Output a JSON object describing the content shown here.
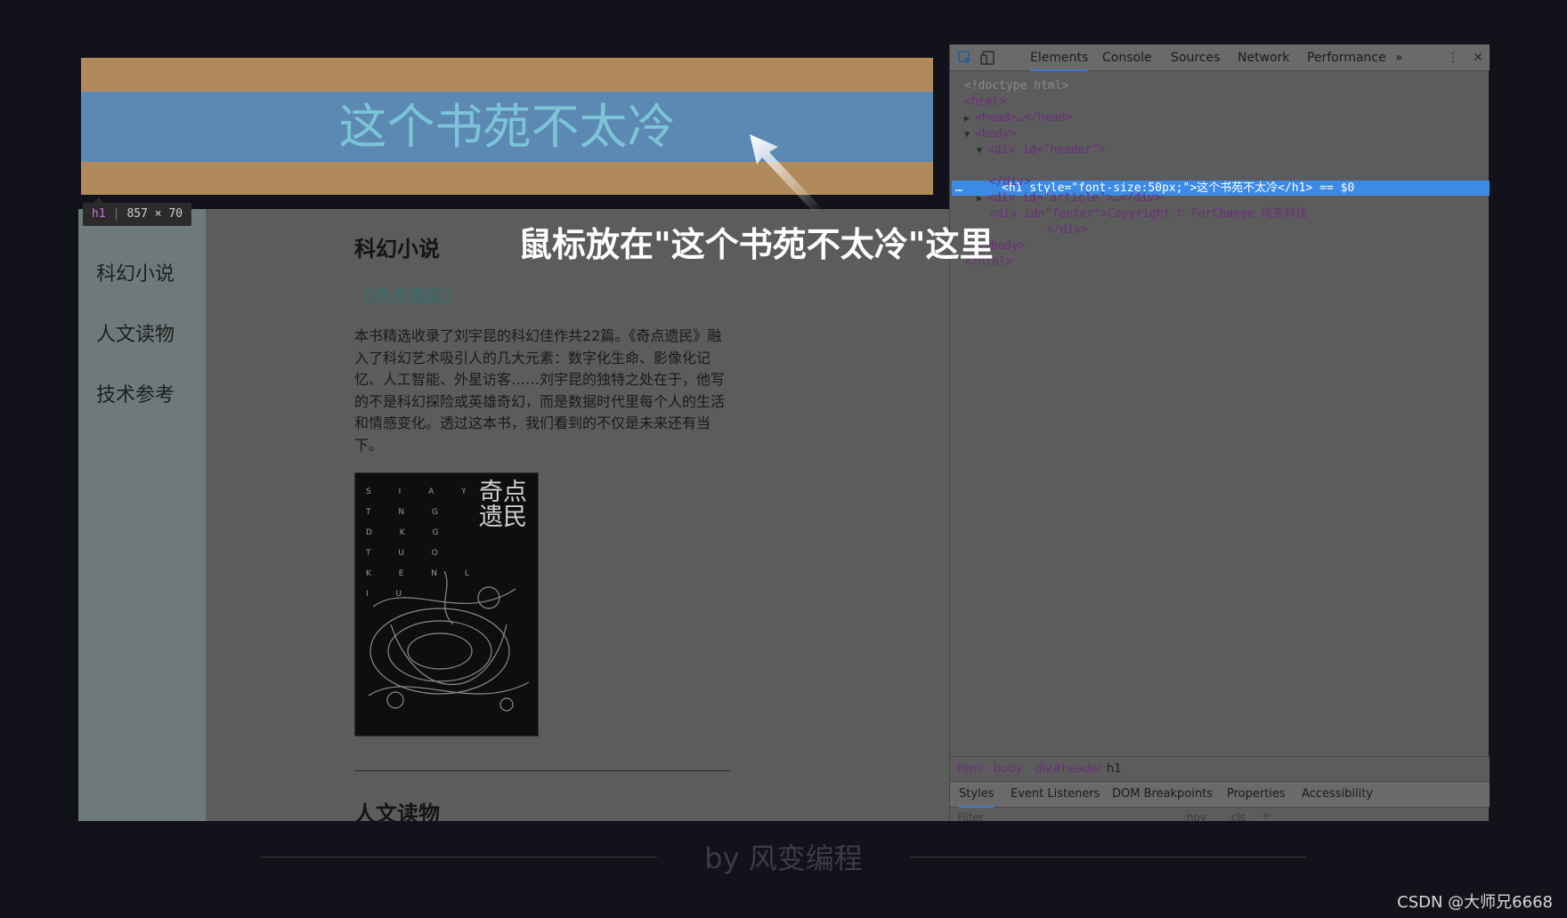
{
  "page": {
    "nav_items": [
      "科幻小说",
      "人文读物",
      "技术参考"
    ],
    "h1_text": "这个书苑不太冷",
    "h1_tooltip": {
      "tag": "h1",
      "size": "857 × 70"
    },
    "article": {
      "section1_title": "科幻小说",
      "book_link": "《奇点遗民》",
      "book_desc": "本书精选收录了刘宇昆的科幻佳作共22篇。《奇点遗民》融入了科幻艺术吸引人的几大元素：数字化生命、影像化记忆、人工智能、外星访客……刘宇昆的独特之处在于，他写的不是科幻探险或英雄奇幻，而是数据时代里每个人的生活和情感变化。透过这本书，我们看到的不仅是未来还有当下。",
      "cover_title": "奇点遗民",
      "cover_tagline": "S I A Y T N G D K G T U O K E N L I U",
      "section2_title": "人文读物"
    }
  },
  "devtools": {
    "tabs": [
      "Elements",
      "Console",
      "Sources",
      "Network",
      "Performance"
    ],
    "more_tabs_icon": "»",
    "code_lines": [
      "<!doctype html>",
      "<html>",
      "<head>…</head>",
      "<body>",
      "<div id=\"header\">",
      "</div>",
      "<div id=\"article\">…</div>",
      "<div id=\"footer\">Copyright © ForChange 风变科技",
      "</div>",
      "</body>",
      "</html>"
    ],
    "selected_line": "<h1 style=\"font-size:50px;\">这个书苑不太冷</h1> == $0",
    "breadcrumb": [
      "html",
      "body",
      "div#header",
      "h1"
    ],
    "subtabs": [
      "Styles",
      "Event Listeners",
      "DOM Breakpoints",
      "Properties",
      "Accessibility"
    ],
    "filter_placeholder": "Filter",
    "filter_hov": ":hov",
    "filter_cls": ".cls",
    "filter_plus": "+"
  },
  "overlay": {
    "annotation": "鼠标放在\"这个书苑不太冷\"这里",
    "footer_brand": "by 风变编程",
    "watermark": "CSDN @大师兄6668"
  },
  "colors": {
    "accent": "#3b8be6",
    "h1_margin": "#b08a5a",
    "h1_content": "#5b89b3",
    "h1_text": "#7cc4d8"
  }
}
